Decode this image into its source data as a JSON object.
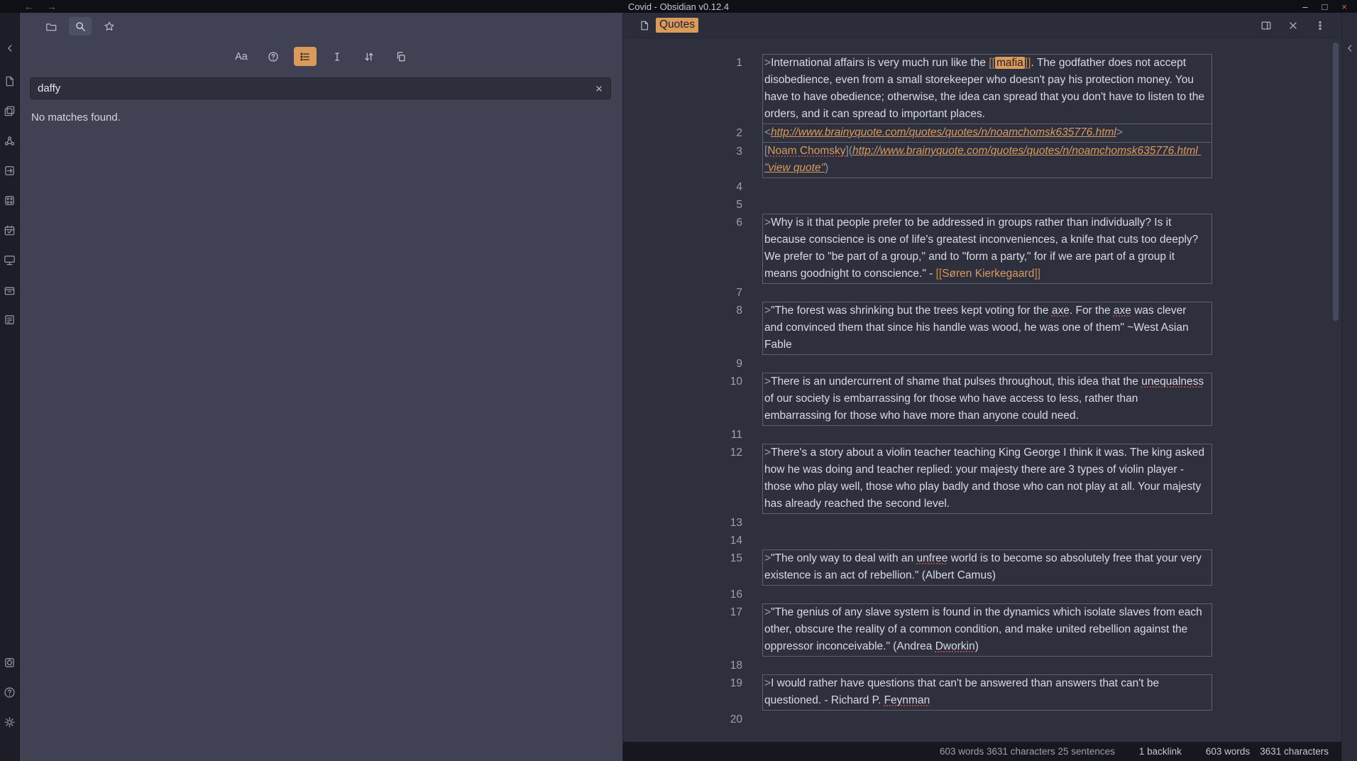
{
  "window": {
    "title": "Covid - Obsidian v0.12.4",
    "controls": {
      "minimize": "–",
      "maximize": "□",
      "close": "×"
    },
    "nav": {
      "back": "←",
      "forward": "→"
    }
  },
  "colors": {
    "accent": "#d99a5b",
    "editor_bg": "#2f303e",
    "panel_bg": "#404254"
  },
  "ribbon": {
    "top": [
      {
        "name": "new-note-icon",
        "shape": "document"
      },
      {
        "name": "stacked-panes-icon",
        "shape": "stack"
      },
      {
        "name": "graph-view-icon",
        "shape": "graph"
      },
      {
        "name": "quick-switcher-icon",
        "shape": "arrowbox"
      },
      {
        "name": "random-note-icon",
        "shape": "dice"
      },
      {
        "name": "calendar-icon",
        "shape": "calendar"
      },
      {
        "name": "presentation-icon",
        "shape": "presentation"
      },
      {
        "name": "archive-icon",
        "shape": "archive"
      },
      {
        "name": "template-icon",
        "shape": "template"
      }
    ],
    "bottom": [
      {
        "name": "vault-switcher-icon",
        "shape": "vault"
      },
      {
        "name": "help-icon",
        "shape": "help"
      },
      {
        "name": "settings-icon",
        "shape": "gear"
      }
    ]
  },
  "search_panel": {
    "tabs": [
      {
        "name": "tab-file-explorer",
        "icon": "folder",
        "active": false
      },
      {
        "name": "tab-search",
        "icon": "search",
        "active": true
      },
      {
        "name": "tab-starred",
        "icon": "star",
        "active": false
      }
    ],
    "toolbar": [
      {
        "name": "match-case-button",
        "label": "Aa",
        "active": false
      },
      {
        "name": "explain-search-button",
        "icon": "help",
        "active": false
      },
      {
        "name": "more-context-button",
        "icon": "list",
        "active": true
      },
      {
        "name": "collapse-results-button",
        "icon": "cursor",
        "active": false
      },
      {
        "name": "sort-order-button",
        "icon": "sort",
        "active": false
      },
      {
        "name": "copy-results-button",
        "icon": "copy",
        "active": false
      }
    ],
    "query": "daffy",
    "no_matches": "No matches found."
  },
  "editor": {
    "title": "Quotes",
    "lines": [
      {
        "n": 1,
        "boxed": true,
        "seg": [
          {
            "t": ">",
            "s": "q"
          },
          {
            "t": "International affairs is very much run like the ",
            "s": "t"
          },
          {
            "t": "[[",
            "s": "br"
          },
          {
            "t": "mafia",
            "s": "hl"
          },
          {
            "t": "]]",
            "s": "br"
          },
          {
            "t": ". The godfather does not accept disobedience, even from a small storekeeper who doesn't pay his protection money. You have to have obedience; otherwise, the idea can spread that you don't have to listen to the orders, and it can spread to important places.",
            "s": "t"
          }
        ]
      },
      {
        "n": 2,
        "boxed": true,
        "seg": [
          {
            "t": "<",
            "s": "dim"
          },
          {
            "t": "http://www.brainyquote.com/quotes/quotes/n/noamchomsk635776.html",
            "s": "url"
          },
          {
            "t": ">",
            "s": "dim"
          }
        ]
      },
      {
        "n": 3,
        "boxed": true,
        "seg": [
          {
            "t": "[",
            "s": "dim"
          },
          {
            "t": "Noam Chomsky",
            "s": "link sp"
          },
          {
            "t": "](",
            "s": "dim"
          },
          {
            "t": "http://www.brainyquote.com/quotes/quotes/n/noamchomsk635776.html \"view quote\"",
            "s": "url"
          },
          {
            "t": ")",
            "s": "dim"
          }
        ]
      },
      {
        "n": 4,
        "boxed": false,
        "seg": []
      },
      {
        "n": 5,
        "boxed": false,
        "seg": []
      },
      {
        "n": 6,
        "boxed": true,
        "seg": [
          {
            "t": ">",
            "s": "q"
          },
          {
            "t": "Why is it that people prefer to be addressed in groups rather than individually? Is it because conscience is one of life's greatest inconveniences, a knife that cuts too deeply? We prefer to \"be part of a group,\" and to \"form a party,\" for if we are part of a group it means goodnight to conscience.\" - ",
            "s": "t"
          },
          {
            "t": "[[",
            "s": "br"
          },
          {
            "t": "Søren Kierkegaard",
            "s": "link"
          },
          {
            "t": "]]",
            "s": "br"
          }
        ]
      },
      {
        "n": 7,
        "boxed": false,
        "seg": []
      },
      {
        "n": 8,
        "boxed": true,
        "seg": [
          {
            "t": ">",
            "s": "q"
          },
          {
            "t": "\"The forest was shrinking but the trees kept voting for the ",
            "s": "t"
          },
          {
            "t": "axe",
            "s": "t sp"
          },
          {
            "t": ". For the ",
            "s": "t"
          },
          {
            "t": "axe",
            "s": "t sp"
          },
          {
            "t": " was clever and convinced them that since his handle was wood, he was one of them\" ~West Asian Fable",
            "s": "t"
          }
        ]
      },
      {
        "n": 9,
        "boxed": false,
        "seg": []
      },
      {
        "n": 10,
        "boxed": true,
        "seg": [
          {
            "t": ">",
            "s": "q"
          },
          {
            "t": "There is an undercurrent of shame that pulses throughout, this idea that the ",
            "s": "t"
          },
          {
            "t": "unequalness",
            "s": "t sp"
          },
          {
            "t": " of our society is embarrassing for those who have access to less, rather than embarrassing for those who have more than anyone could need.",
            "s": "t"
          }
        ]
      },
      {
        "n": 11,
        "boxed": false,
        "seg": []
      },
      {
        "n": 12,
        "boxed": true,
        "seg": [
          {
            "t": ">",
            "s": "q"
          },
          {
            "t": "There's a story about a violin teacher teaching King George I think it was. The king asked how he was doing and teacher replied: your majesty there are 3 types of violin player - those who play well, those who play badly and those who can not play at all. Your majesty has already reached the second level.",
            "s": "t"
          }
        ]
      },
      {
        "n": 13,
        "boxed": false,
        "seg": []
      },
      {
        "n": 14,
        "boxed": false,
        "seg": []
      },
      {
        "n": 15,
        "boxed": true,
        "seg": [
          {
            "t": ">",
            "s": "q"
          },
          {
            "t": "\"The only way to deal with an ",
            "s": "t"
          },
          {
            "t": "unfree",
            "s": "t sp"
          },
          {
            "t": " world is to become so absolutely free that your very existence is an act of rebellion.\" (Albert Camus)",
            "s": "t"
          }
        ]
      },
      {
        "n": 16,
        "boxed": false,
        "seg": []
      },
      {
        "n": 17,
        "boxed": true,
        "seg": [
          {
            "t": ">",
            "s": "q"
          },
          {
            "t": "\"The genius of any slave system is found in the dynamics which isolate slaves from each other, obscure the reality of a common condition, and make united rebellion against the oppressor inconceivable.\" (Andrea ",
            "s": "t"
          },
          {
            "t": "Dworkin",
            "s": "t sp"
          },
          {
            "t": ")",
            "s": "t"
          }
        ]
      },
      {
        "n": 18,
        "boxed": false,
        "seg": []
      },
      {
        "n": 19,
        "boxed": true,
        "seg": [
          {
            "t": ">",
            "s": "q"
          },
          {
            "t": "I would rather have questions that can't be answered than answers that can't be questioned. - Richard P. ",
            "s": "t"
          },
          {
            "t": "Feynman",
            "s": "t sp"
          }
        ]
      },
      {
        "n": 20,
        "boxed": false,
        "seg": []
      }
    ]
  },
  "status_bar": {
    "stats": "603 words 3631 characters 25 sentences",
    "backlinks": "1 backlink",
    "words": "603 words",
    "characters": "3631 characters"
  }
}
